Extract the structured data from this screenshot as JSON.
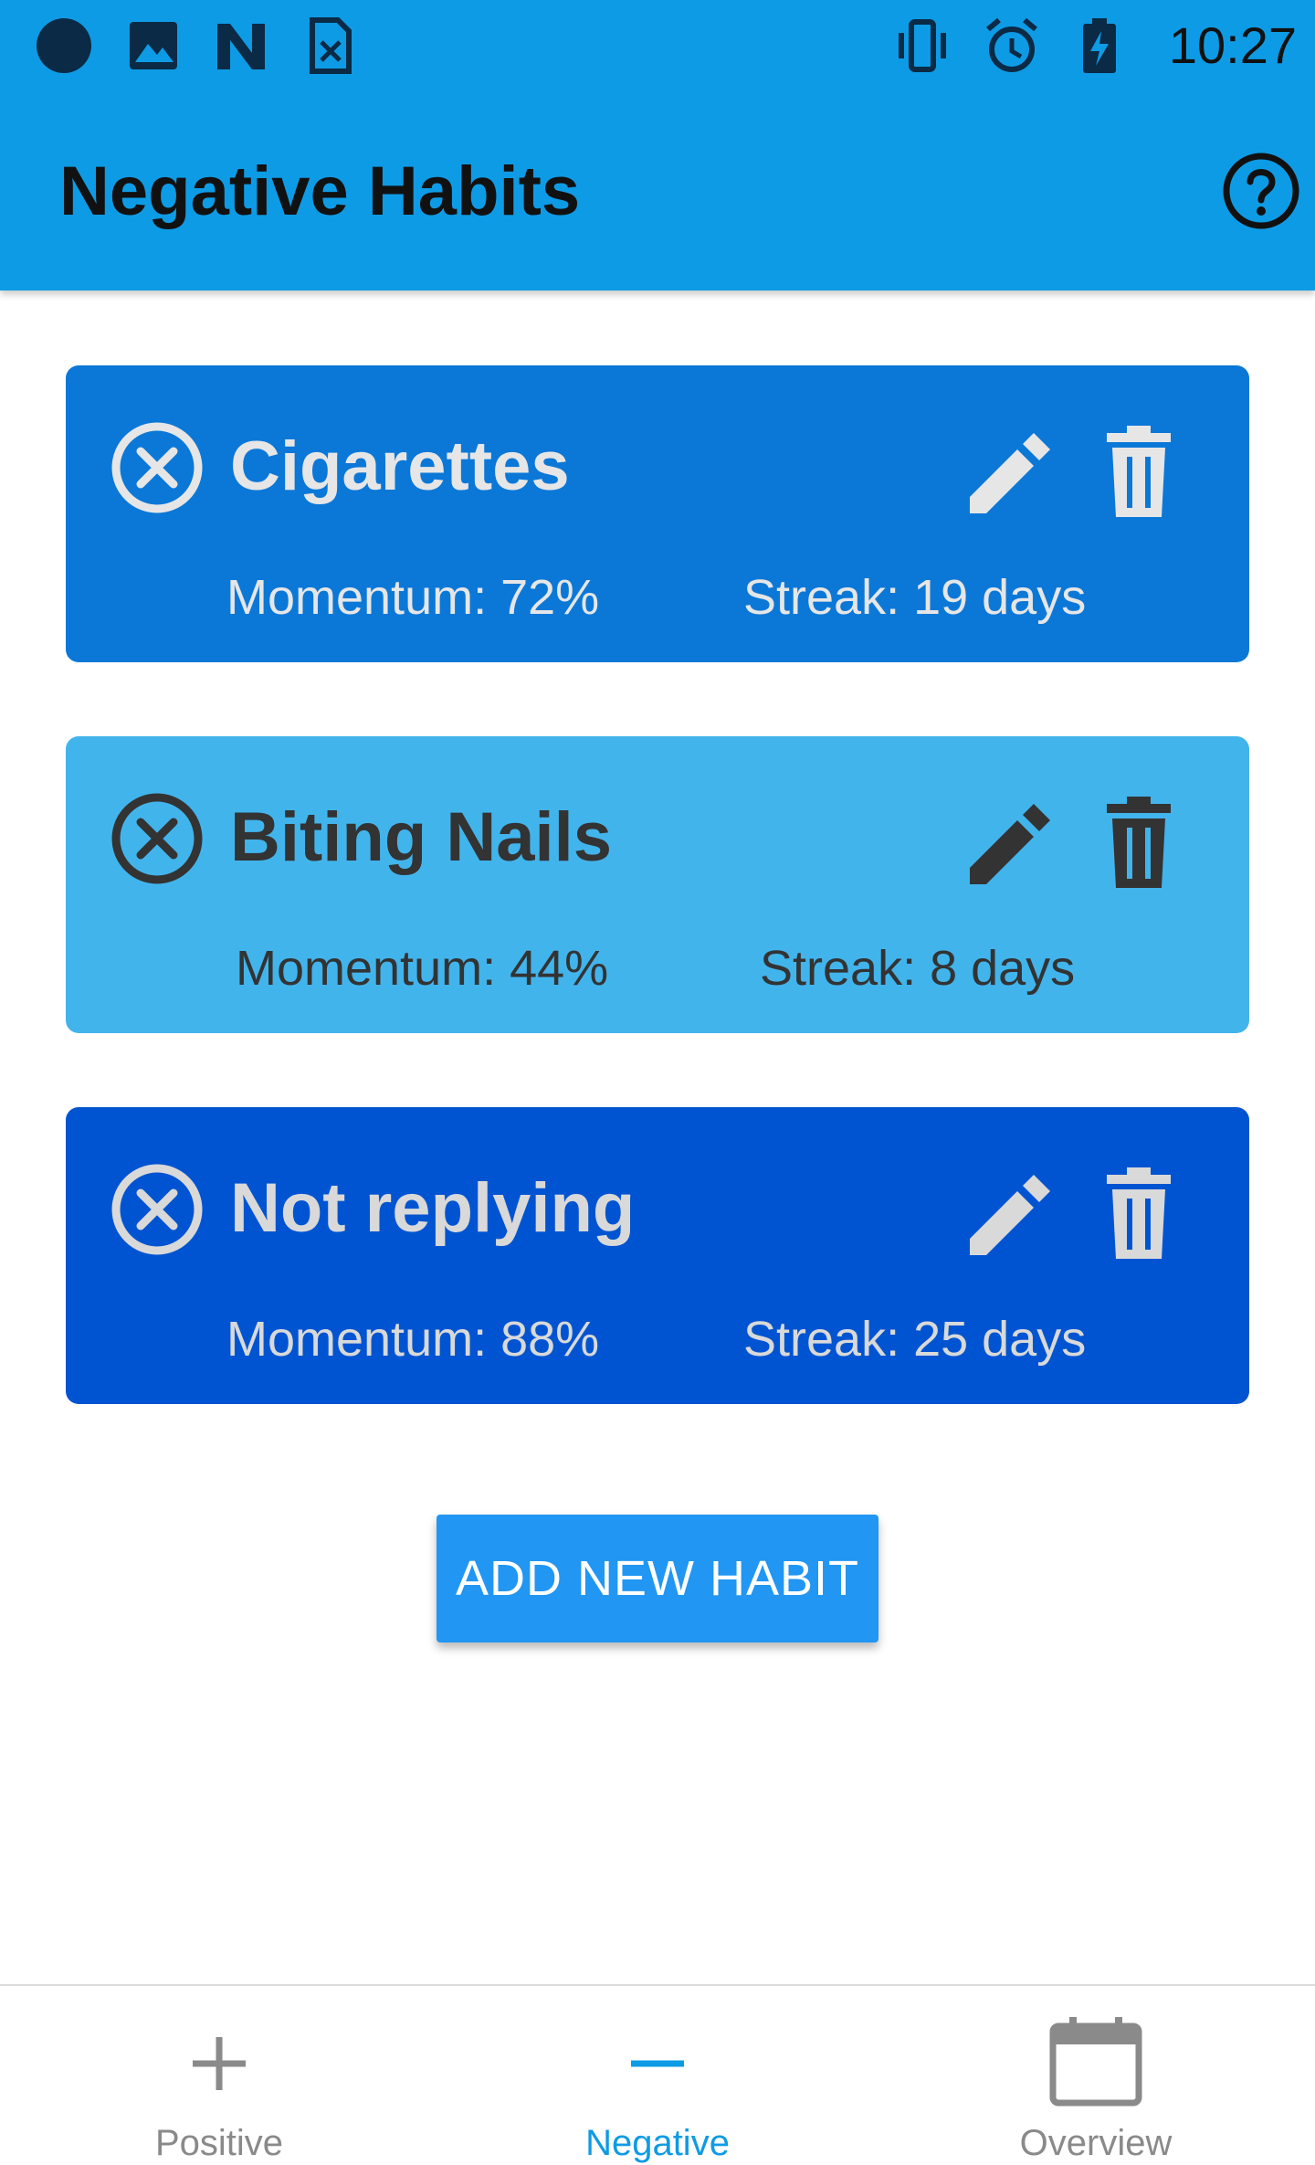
{
  "status_bar": {
    "time": "10:27",
    "left_icons": [
      "record-dot-icon",
      "image-icon",
      "n-logo-icon",
      "sim-card-icon"
    ],
    "right_icons": [
      "vibrate-icon",
      "alarm-icon",
      "battery-charging-icon"
    ]
  },
  "app_bar": {
    "title": "Negative Habits",
    "help_icon": "help-circle-icon",
    "background": "#0E9BE5"
  },
  "habits": [
    {
      "name": "Cigarettes",
      "momentum": "Momentum: 72%",
      "streak": "Streak: 19 days",
      "card_color": "#0B78D8",
      "text_color": "#E6E6E6"
    },
    {
      "name": "Biting Nails",
      "momentum": "Momentum: 44%",
      "streak": "Streak: 8 days",
      "card_color": "#42B4EC",
      "text_color": "#333333"
    },
    {
      "name": "Not replying",
      "momentum": "Momentum: 88%",
      "streak": "Streak: 25 days",
      "card_color": "#0154D1",
      "text_color": "#D9D9D9"
    }
  ],
  "add_button": {
    "label": "ADD NEW HABIT",
    "color": "#2196F3"
  },
  "bottom_nav": {
    "items": [
      {
        "label": "Positive",
        "icon": "plus-icon",
        "active": false
      },
      {
        "label": "Negative",
        "icon": "minus-icon",
        "active": true
      },
      {
        "label": "Overview",
        "icon": "calendar-icon",
        "active": false
      }
    ],
    "active_color": "#0E9BE5",
    "inactive_color": "#8A8A8A"
  }
}
